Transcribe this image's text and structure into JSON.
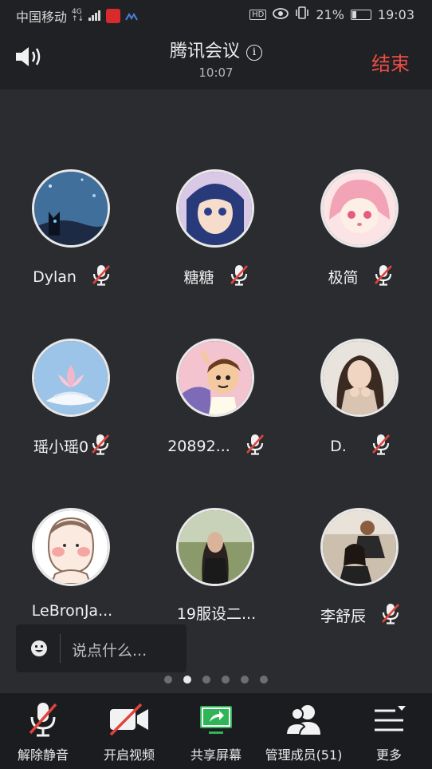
{
  "status_bar": {
    "carrier": "中国移动",
    "network_top": "4G",
    "network_bottom": "↑↓",
    "hd": "HD",
    "battery_percent": "21%",
    "battery_level": 0.21,
    "time": "19:03"
  },
  "header": {
    "title": "腾讯会议",
    "duration": "10:07",
    "end_label": "结束"
  },
  "participants": [
    {
      "name": "Dylan",
      "muted": true,
      "avatar": "cat-night-avatar"
    },
    {
      "name": "糖糖",
      "muted": true,
      "avatar": "anime-girl-blue-avatar"
    },
    {
      "name": "极简",
      "muted": true,
      "avatar": "anime-girl-pink-avatar"
    },
    {
      "name": "瑶小瑶0",
      "muted": true,
      "avatar": "lotus-avatar"
    },
    {
      "name": "20892...",
      "muted": true,
      "avatar": "cartoon-boy-avatar"
    },
    {
      "name": "D.",
      "muted": true,
      "avatar": "photo-girl-avatar"
    },
    {
      "name": "LeBronJa...",
      "muted": false,
      "avatar": "cartoon-baby-avatar"
    },
    {
      "name": "19服设二...",
      "muted": false,
      "avatar": "photo-woman-avatar"
    },
    {
      "name": "李舒辰",
      "muted": true,
      "avatar": "photo-couple-avatar"
    }
  ],
  "chat": {
    "placeholder": "说点什么..."
  },
  "pagination": {
    "total": 6,
    "active": 2
  },
  "toolbar": {
    "unmute": "解除静音",
    "video": "开启视频",
    "share": "共享屏幕",
    "members": "管理成员(51)",
    "more": "更多"
  },
  "colors": {
    "end": "#ec4d45",
    "share_green": "#2fb457",
    "mute_red": "#e0443c"
  }
}
